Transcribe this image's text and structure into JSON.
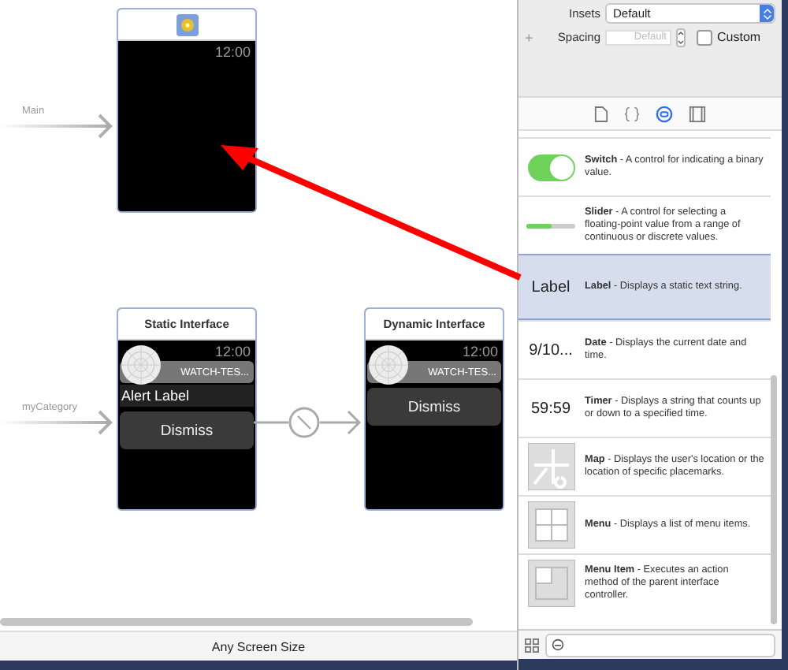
{
  "canvas": {
    "scenes": [
      {
        "kind": "main",
        "entry_label": "Main",
        "time": "12:00"
      },
      {
        "kind": "static",
        "title": "Static Interface",
        "time": "12:00",
        "app_name": "WATCH-TES...",
        "alert": "Alert Label",
        "button": "Dismiss",
        "entry_label": "myCategory"
      },
      {
        "kind": "dynamic",
        "title": "Dynamic Interface",
        "time": "12:00",
        "app_name": "WATCH-TES...",
        "button": "Dismiss"
      }
    ],
    "size_label": "Any Screen Size"
  },
  "inspector": {
    "insets": {
      "label": "Insets",
      "value": "Default"
    },
    "spacing": {
      "label": "Spacing",
      "placeholder": "Default"
    },
    "custom": {
      "label": "Custom",
      "checked": false
    },
    "add": "+"
  },
  "library": {
    "tabs": [
      {
        "kind": "file",
        "selected": false
      },
      {
        "kind": "braces",
        "selected": false
      },
      {
        "kind": "object",
        "selected": true
      },
      {
        "kind": "media",
        "selected": false
      }
    ],
    "items": [
      {
        "kind": "switch",
        "on": true,
        "description": "**Switch** - A control for indicating a binary value.",
        "selected": false
      },
      {
        "kind": "slider",
        "level": 0.5,
        "description": "**Slider** - A control for selecting a floating-point value from a range of continuous or discrete values.",
        "selected": false
      },
      {
        "kind": "text",
        "preview": "Label",
        "description": "**Label** - Displays a static text string.",
        "selected": true
      },
      {
        "kind": "text",
        "preview": "9/10...",
        "description": "**Date** - Displays the current date and time.",
        "selected": false
      },
      {
        "kind": "text",
        "preview": "59:59",
        "description": "**Timer** - Displays a string that counts up or down to a specified time.",
        "selected": false
      },
      {
        "kind": "map",
        "description": "**Map** - Displays the user's location or the location of specific placemarks.",
        "selected": false
      },
      {
        "kind": "menu",
        "description": "**Menu** - Displays a list of menu items.",
        "selected": false
      },
      {
        "kind": "menu_item",
        "description": "**Menu Item** - Executes an action method of the parent interface controller.",
        "selected": false
      }
    ]
  }
}
